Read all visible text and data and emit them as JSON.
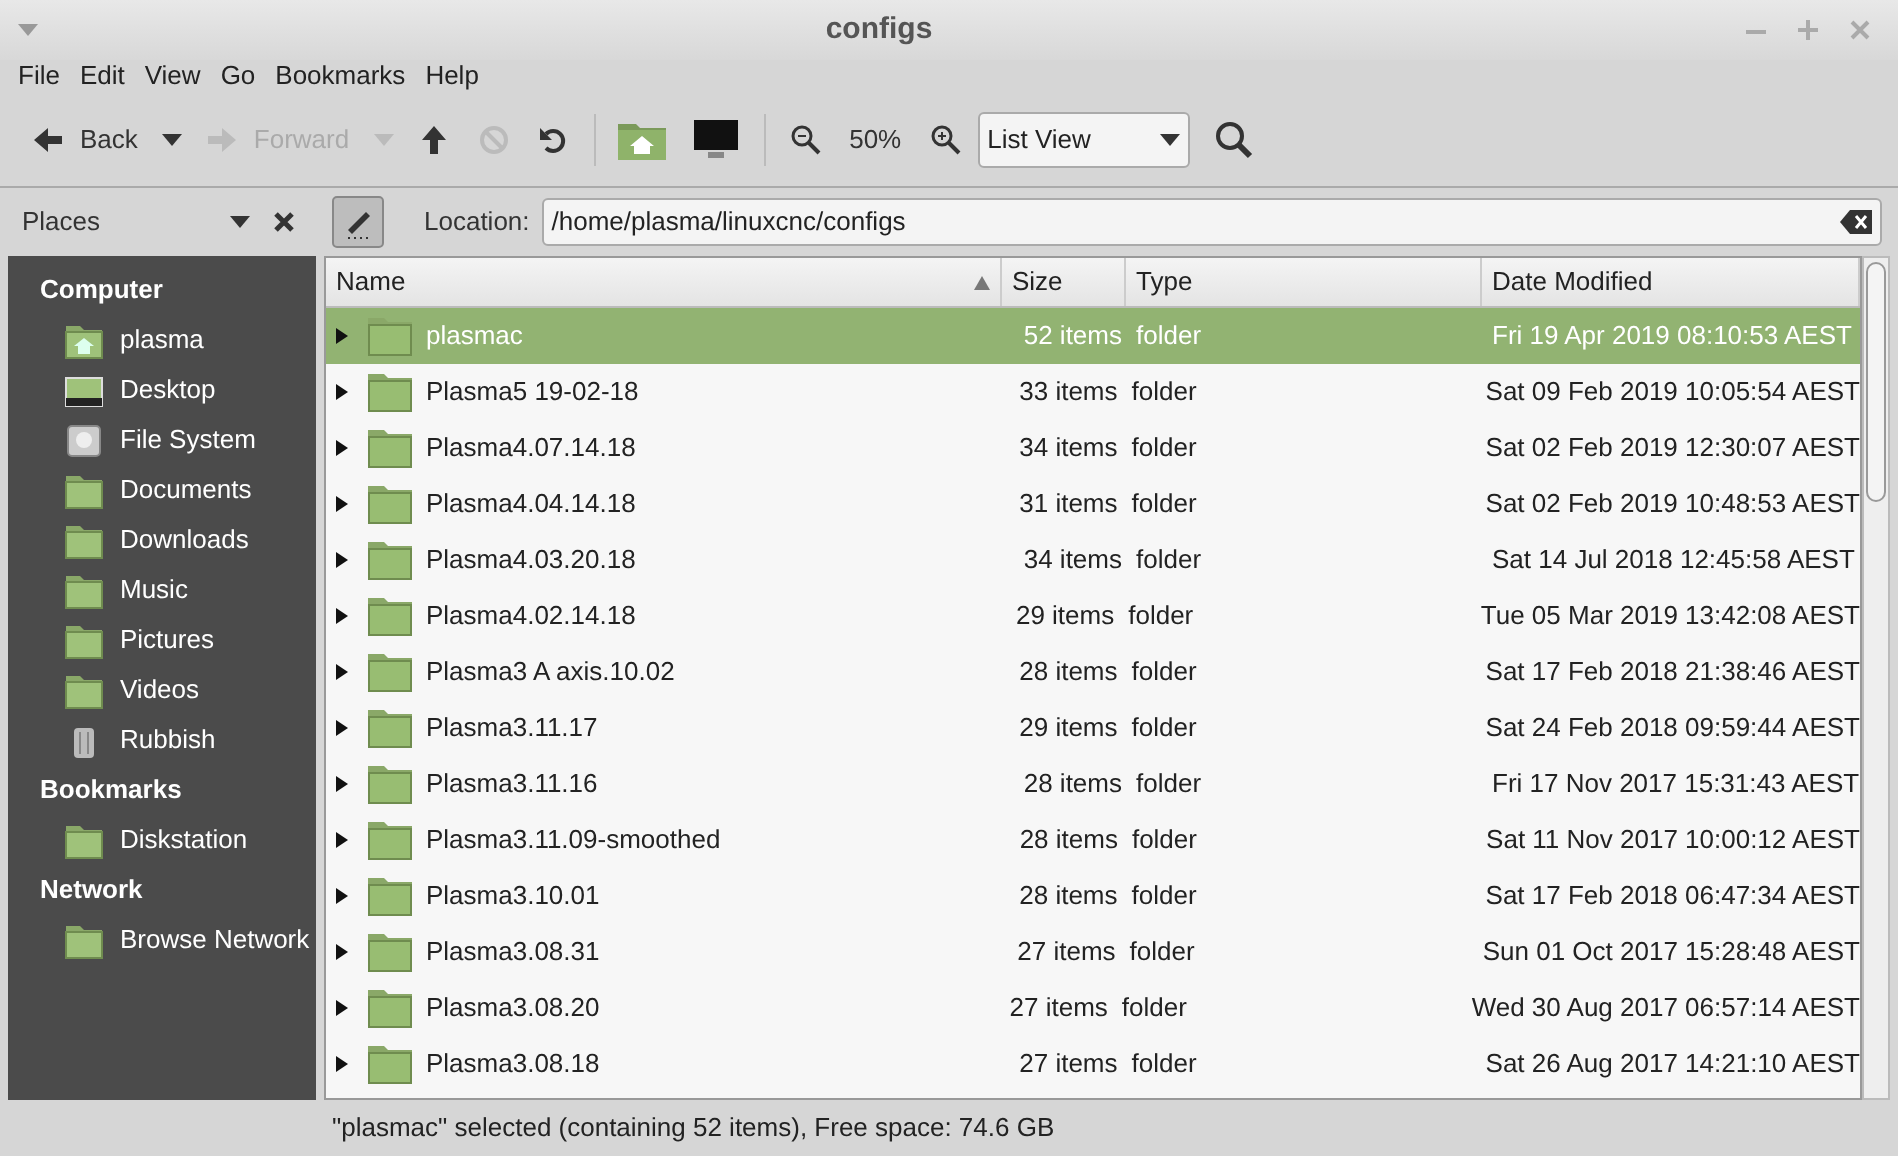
{
  "window": {
    "title": "configs"
  },
  "menu": [
    "File",
    "Edit",
    "View",
    "Go",
    "Bookmarks",
    "Help"
  ],
  "toolbar": {
    "back": {
      "label": "Back",
      "disabled": false
    },
    "forward": {
      "label": "Forward",
      "disabled": true
    },
    "stop": {
      "disabled": true
    },
    "zoom": "50%",
    "view": "List View"
  },
  "places": {
    "label": "Places",
    "location_label": "Location:",
    "location": "/home/plasma/linuxcnc/configs"
  },
  "sidebar": [
    {
      "heading": "Computer",
      "items": [
        {
          "label": "plasma",
          "kind": "home"
        },
        {
          "label": "Desktop",
          "kind": "desktop"
        },
        {
          "label": "File System",
          "kind": "drive"
        },
        {
          "label": "Documents",
          "kind": "folder"
        },
        {
          "label": "Downloads",
          "kind": "folder"
        },
        {
          "label": "Music",
          "kind": "folder"
        },
        {
          "label": "Pictures",
          "kind": "folder"
        },
        {
          "label": "Videos",
          "kind": "folder"
        },
        {
          "label": "Rubbish",
          "kind": "trash"
        }
      ]
    },
    {
      "heading": "Bookmarks",
      "items": [
        {
          "label": "Diskstation",
          "kind": "folder"
        }
      ]
    },
    {
      "heading": "Network",
      "items": [
        {
          "label": "Browse Network",
          "kind": "folder"
        }
      ]
    }
  ],
  "table": {
    "columns": [
      "Name",
      "Size",
      "Type",
      "Date Modified"
    ],
    "rows": [
      {
        "name": "plasmac",
        "size": "52 items",
        "type": "folder",
        "date": "Fri 19 Apr 2019 08:10:53 AEST",
        "selected": true
      },
      {
        "name": "Plasma5 19-02-18",
        "size": "33 items",
        "type": "folder",
        "date": "Sat 09 Feb 2019 10:05:54 AEST",
        "selected": false
      },
      {
        "name": "Plasma4.07.14.18",
        "size": "34 items",
        "type": "folder",
        "date": "Sat 02 Feb 2019 12:30:07 AEST",
        "selected": false
      },
      {
        "name": "Plasma4.04.14.18",
        "size": "31 items",
        "type": "folder",
        "date": "Sat 02 Feb 2019 10:48:53 AEST",
        "selected": false
      },
      {
        "name": "Plasma4.03.20.18",
        "size": "34 items",
        "type": "folder",
        "date": "Sat 14 Jul 2018 12:45:58 AEST",
        "selected": false
      },
      {
        "name": "Plasma4.02.14.18",
        "size": "29 items",
        "type": "folder",
        "date": "Tue 05 Mar 2019 13:42:08 AEST",
        "selected": false
      },
      {
        "name": "Plasma3 A axis.10.02",
        "size": "28 items",
        "type": "folder",
        "date": "Sat 17 Feb 2018 21:38:46 AEST",
        "selected": false
      },
      {
        "name": "Plasma3.11.17",
        "size": "29 items",
        "type": "folder",
        "date": "Sat 24 Feb 2018 09:59:44 AEST",
        "selected": false
      },
      {
        "name": "Plasma3.11.16",
        "size": "28 items",
        "type": "folder",
        "date": "Fri 17 Nov 2017 15:31:43 AEST",
        "selected": false
      },
      {
        "name": "Plasma3.11.09-smoothed",
        "size": "28 items",
        "type": "folder",
        "date": "Sat 11 Nov 2017 10:00:12 AEST",
        "selected": false
      },
      {
        "name": "Plasma3.10.01",
        "size": "28 items",
        "type": "folder",
        "date": "Sat 17 Feb 2018 06:47:34 AEST",
        "selected": false
      },
      {
        "name": "Plasma3.08.31",
        "size": "27 items",
        "type": "folder",
        "date": "Sun 01 Oct 2017 15:28:48 AEST",
        "selected": false
      },
      {
        "name": "Plasma3.08.20",
        "size": "27 items",
        "type": "folder",
        "date": "Wed 30 Aug 2017 06:57:14 AEST",
        "selected": false
      },
      {
        "name": "Plasma3.08.18",
        "size": "27 items",
        "type": "folder",
        "date": "Sat 26 Aug 2017 14:21:10 AEST",
        "selected": false
      }
    ]
  },
  "status_bar": "\"plasmac\" selected (containing 52 items), Free space: 74.6 GB"
}
